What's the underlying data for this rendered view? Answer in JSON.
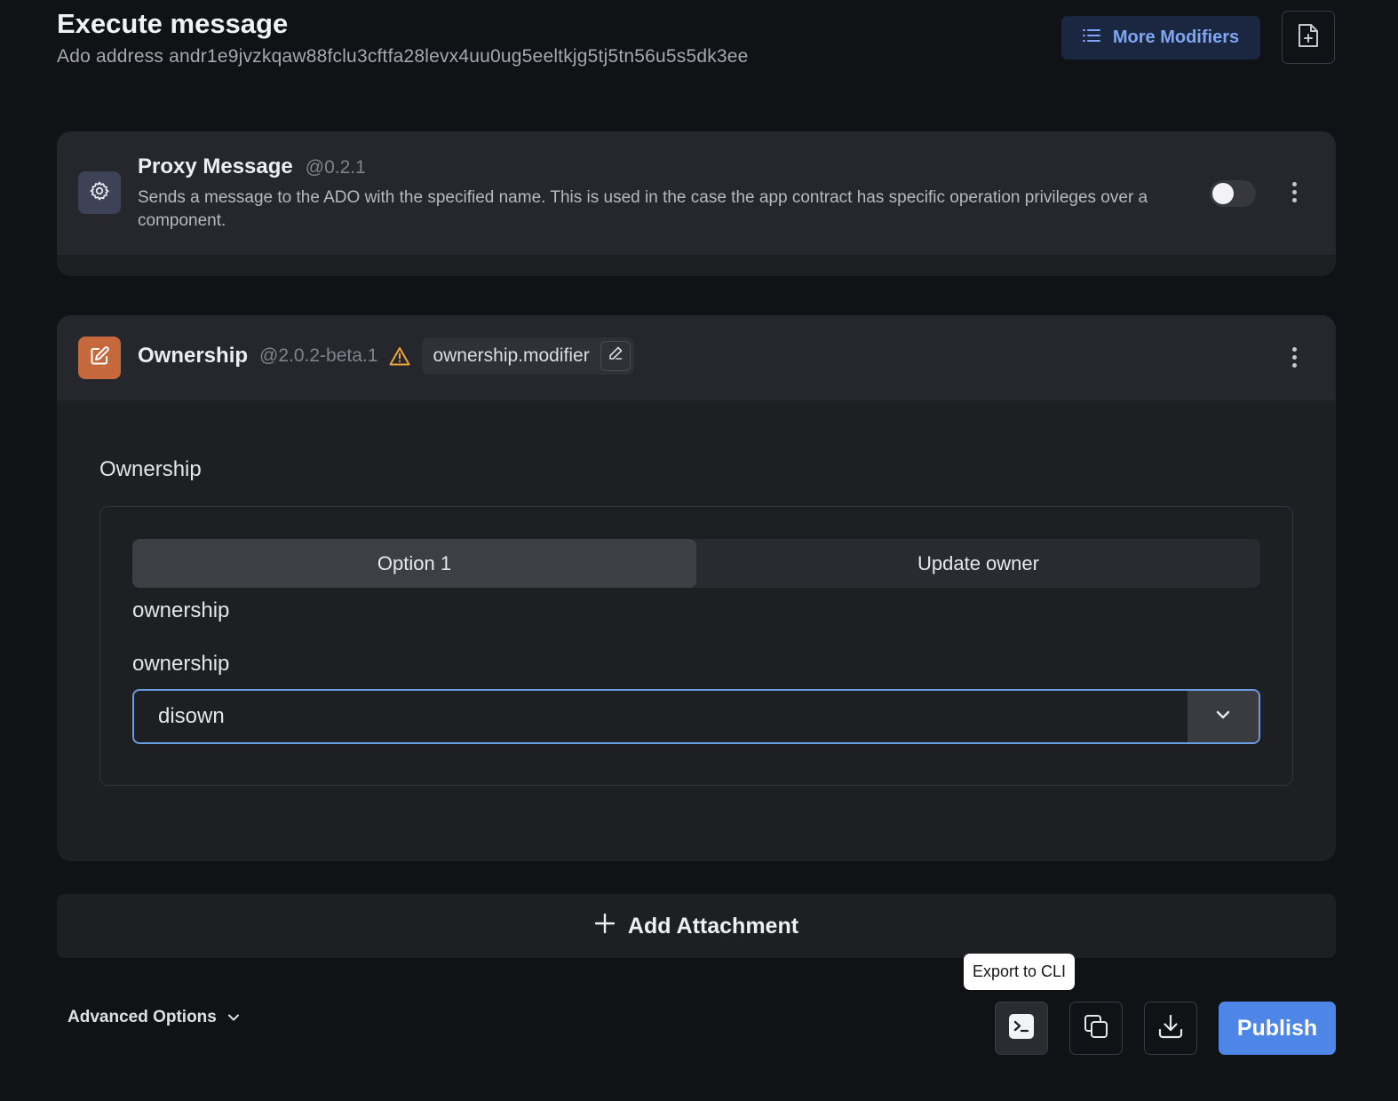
{
  "header": {
    "title": "Execute message",
    "ado_address": "Ado address andr1e9jvzkqaw88fclu3cftfa28levx4uu0ug5eeltkjg5tj5tn56u5s5dk3ee",
    "more_modifiers_label": "More Modifiers"
  },
  "proxy_module": {
    "name": "Proxy Message",
    "version": "@0.2.1",
    "description": "Sends a message to the ADO with the specified name. This is used in the case the app contract has specific operation privileges over a component.",
    "enabled": false
  },
  "ownership_module": {
    "name": "Ownership",
    "version": "@2.0.2-beta.1",
    "alias": "ownership.modifier",
    "section_label": "Ownership",
    "tabs": [
      {
        "label": "Option 1",
        "active": true
      },
      {
        "label": "Update owner",
        "active": false
      }
    ],
    "field_label_1": "ownership",
    "field_label_2": "ownership",
    "select_value": "disown"
  },
  "add_attachment_label": "Add Attachment",
  "advanced_options_label": "Advanced Options",
  "tooltip": "Export to CLI",
  "publish_label": "Publish",
  "colors": {
    "accent": "#4e86e8",
    "ownership_icon_bg": "#c5683b",
    "warning": "#f0a53c"
  },
  "icons": [
    "list-icon",
    "file-plus-icon",
    "gear-icon",
    "edit-icon",
    "warning-icon",
    "pencil-icon",
    "chevron-down-icon",
    "plus-icon",
    "terminal-icon",
    "copy-icon",
    "download-icon",
    "kebab-icon"
  ]
}
